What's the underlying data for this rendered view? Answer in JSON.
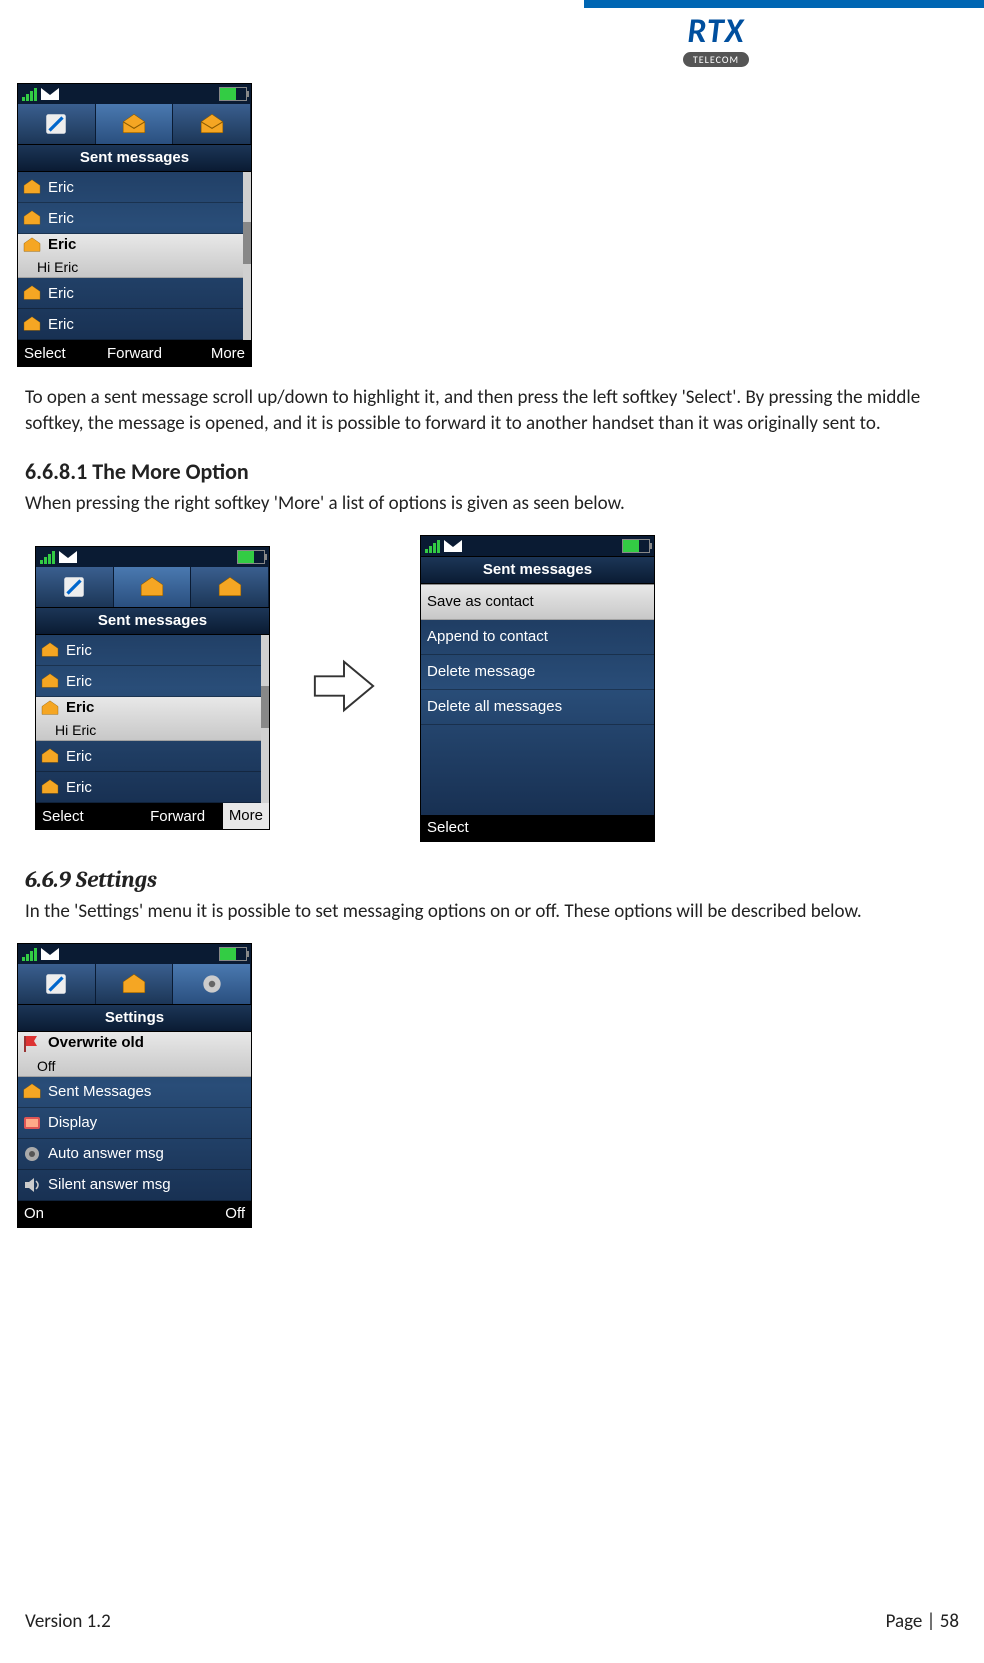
{
  "logo": {
    "brand": "RTX",
    "sub": "TELECOM"
  },
  "fig1": {
    "title": "Sent messages",
    "rows": [
      {
        "name": "Eric"
      },
      {
        "name": "Eric"
      },
      {
        "name": "Eric",
        "preview": "Hi Eric",
        "selected": true
      },
      {
        "name": "Eric"
      },
      {
        "name": "Eric"
      }
    ],
    "sk": {
      "left": "Select",
      "mid": "Forward",
      "right": "More"
    }
  },
  "para1": "To open a sent message scroll up/down to highlight it, and then press the left softkey 'Select'. By pressing the middle softkey, the message is opened, and it is possible to forward it to another handset than it was originally sent to.",
  "sec6681": {
    "heading": "6.6.8.1 The More Option",
    "text": "When pressing the right softkey 'More' a list of options is given as seen below."
  },
  "fig2a": {
    "title": "Sent messages",
    "rows": [
      {
        "name": "Eric"
      },
      {
        "name": "Eric"
      },
      {
        "name": "Eric",
        "preview": "Hi Eric",
        "selected": true
      },
      {
        "name": "Eric"
      },
      {
        "name": "Eric"
      }
    ],
    "sk": {
      "left": "Select",
      "mid": "Forward",
      "right": "More",
      "highlight_right": true
    }
  },
  "fig2b": {
    "title": "Sent messages",
    "options": [
      {
        "label": "Save as contact",
        "selected": true
      },
      {
        "label": "Append to contact"
      },
      {
        "label": "Delete message"
      },
      {
        "label": "Delete all messages"
      }
    ],
    "sk": {
      "left": "Select"
    }
  },
  "sec669": {
    "heading": "6.6.9 Settings",
    "text": "In the 'Settings' menu it is possible to set messaging options on or off. These options will be described below."
  },
  "fig3": {
    "title": "Settings",
    "rows": [
      {
        "label": "Overwrite old",
        "value": "Off",
        "selected": true,
        "icon": "flag"
      },
      {
        "label": "Sent Messages",
        "icon": "envelope"
      },
      {
        "label": "Display",
        "icon": "display"
      },
      {
        "label": "Auto answer msg",
        "icon": "gear"
      },
      {
        "label": "Silent answer msg",
        "icon": "speaker"
      }
    ],
    "sk": {
      "left": "On",
      "right": "Off"
    }
  },
  "footer": {
    "version": "Version 1.2",
    "page": "Page | 58"
  }
}
